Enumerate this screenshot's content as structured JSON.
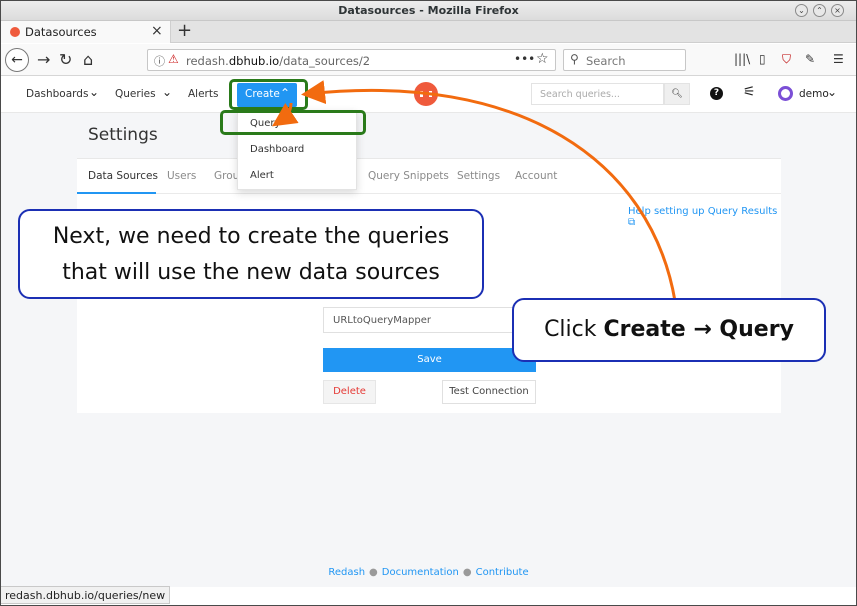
{
  "window": {
    "title": "Datasources - Mozilla Firefox"
  },
  "tab": {
    "title": "Datasources",
    "close": "×",
    "new_tab": "+"
  },
  "navbar": {
    "url_host": "redash.dbhub.io",
    "url_path": "/data_sources/2",
    "url_prefix": "redash.",
    "url_domain": "dbhub.io",
    "search_placeholder": "Search",
    "more": "•••"
  },
  "app": {
    "nav": {
      "dashboards": "Dashboards",
      "queries": "Queries",
      "alerts": "Alerts",
      "create": "Create"
    },
    "search_placeholder": "Search queries...",
    "username": "demo",
    "create_menu": [
      "Query",
      "Dashboard",
      "Alert"
    ],
    "page_title": "Settings",
    "settings_tabs": [
      "Data Sources",
      "Users",
      "Grou",
      "Query Snippets",
      "Settings",
      "Account"
    ],
    "help_link": "Help setting up Query Results",
    "name_value": "URLtoQueryMapper",
    "save": "Save",
    "delete": "Delete",
    "test_connection": "Test Connection",
    "footer": [
      "Redash",
      "Documentation",
      "Contribute"
    ]
  },
  "status_bar": "redash.dbhub.io/queries/new",
  "annotations": {
    "callout_left_line1": "Next, we need to create the queries",
    "callout_left_line2": "that will use the new data sources",
    "callout_right_prefix": "Click ",
    "callout_right_bold": "Create → Query",
    "arrow_color": "#f26b0f",
    "highlight_color": "#2a7a1a"
  }
}
